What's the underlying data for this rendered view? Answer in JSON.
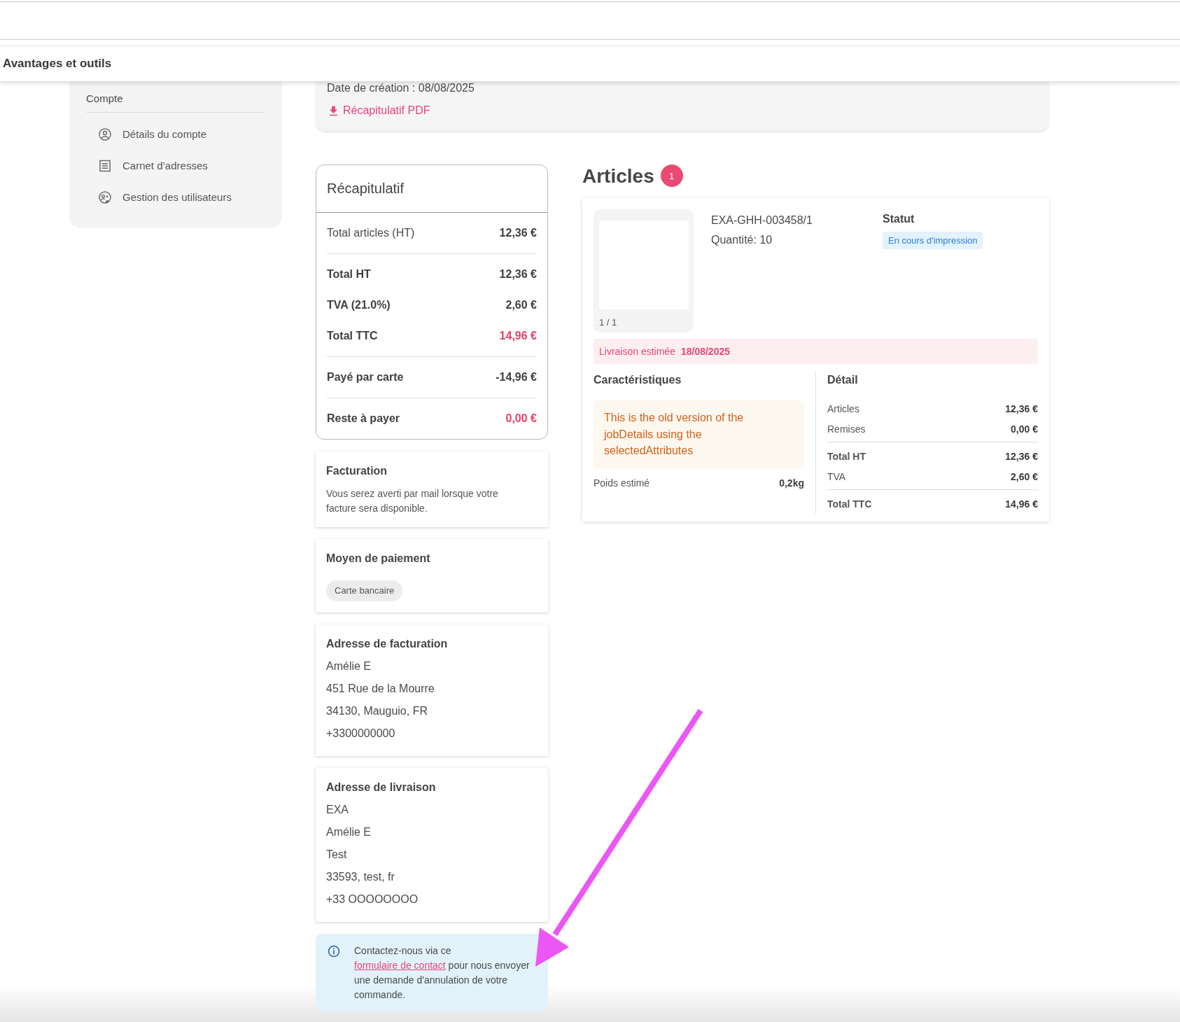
{
  "top_nav": {
    "title": "Avantages et outils"
  },
  "sidebar": {
    "section": "Compte",
    "items": [
      {
        "label": "Détails du compte",
        "selected": false
      },
      {
        "label": "Carnet d’adresses",
        "selected": false
      },
      {
        "label": "Gestion des utilisateurs",
        "selected": false
      }
    ]
  },
  "order": {
    "created": "Date de création : 08/08/2025",
    "pdf_link": "Récapitulatif PDF"
  },
  "summary": {
    "title": "Récapitulatif",
    "groups": [
      {
        "rows": [
          {
            "label": "Total articles (HT)",
            "value": "12,36 €",
            "kind": "plain"
          }
        ]
      },
      {
        "rows": [
          {
            "label": "Total HT",
            "value": "12,36 €",
            "kind": "strong"
          },
          {
            "label": "TVA (21.0%)",
            "value": "2,60 €",
            "kind": "strong"
          },
          {
            "label": "Total TTC",
            "value": "14,96 €",
            "kind": "accent"
          }
        ]
      },
      {
        "rows": [
          {
            "label": "Payé par carte",
            "value": "-14,96 €",
            "kind": "strong"
          }
        ]
      },
      {
        "rows": [
          {
            "label": "Reste à payer",
            "value": "0,00 €",
            "kind": "accent"
          }
        ]
      }
    ]
  },
  "billing": {
    "title": "Facturation",
    "text": "Vous serez averti par mail lorsque votre facture sera disponible."
  },
  "payment": {
    "title": "Moyen de paiement",
    "method": "Carte bancaire"
  },
  "billing_address": {
    "title": "Adresse de facturation",
    "lines": [
      "Amélie E",
      "451 Rue de la Mourre",
      "34130, Mauguio, FR",
      "+3300000000"
    ]
  },
  "delivery_address": {
    "title": "Adresse de livraison",
    "lines": [
      "EXA",
      "Amélie E",
      "Test",
      "33593, test, fr",
      "+33 OOOOOOOO"
    ]
  },
  "notice": {
    "before": "Contactez-nous via ce ",
    "link": "formulaire de contact",
    "after": " pour nous envoyer une demande d'annulation de votre commande."
  },
  "articles": {
    "title": "Articles",
    "count": "1",
    "items": [
      {
        "page": "1 / 1",
        "reference": "EXA-GHH-003458/1",
        "quantity": "Quantité: 10",
        "status_label": "Statut",
        "status": "En cours d'impression",
        "delivery_label": "Livraison estimée",
        "delivery_date": "18/08/2025",
        "features": {
          "title": "Caractéristiques",
          "note": "This is the old version of the jobDetails using the selectedAttributes",
          "rows": [
            {
              "label": "Poids estimé",
              "value": "0,2kg"
            }
          ]
        },
        "detail": {
          "title": "Détail",
          "groups": [
            {
              "rows": [
                {
                  "label": "Articles",
                  "value": "12,36 €",
                  "kind": "plain"
                },
                {
                  "label": "Remises",
                  "value": "0,00 €",
                  "kind": "plain"
                }
              ]
            },
            {
              "rows": [
                {
                  "label": "Total HT",
                  "value": "12,36 €",
                  "kind": "strong"
                },
                {
                  "label": "TVA",
                  "value": "2,60 €",
                  "kind": "plain"
                }
              ]
            },
            {
              "rows": [
                {
                  "label": "Total TTC",
                  "value": "14,96 €",
                  "kind": "strong"
                }
              ]
            }
          ]
        }
      }
    ]
  }
}
